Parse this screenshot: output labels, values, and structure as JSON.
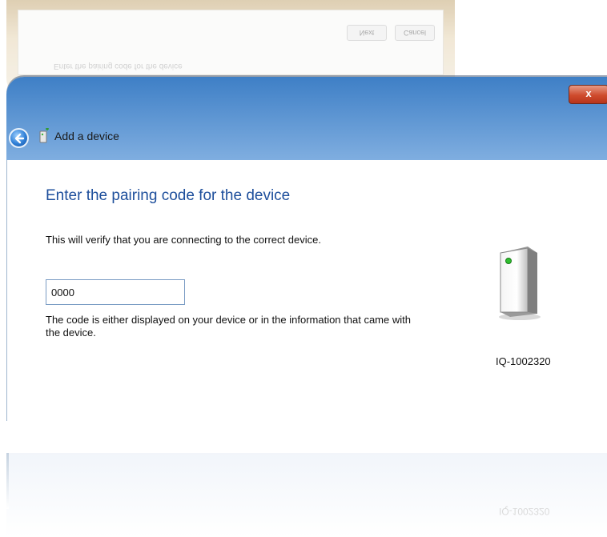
{
  "background_window": {
    "next_label": "Next",
    "cancel_label": "Cancel",
    "mirrored_text": "Enter the pairing code for the device"
  },
  "window": {
    "close_label": "x",
    "title": "Add a device"
  },
  "content": {
    "heading": "Enter the pairing code for the device",
    "description": "This will verify that you are connecting to the correct device.",
    "pairing_code_value": "0000",
    "hint": "The code is either displayed on your device or in the information that came with the device.",
    "device_name": "IQ-1002320"
  },
  "reflection": {
    "device_name": "IQ-1002320"
  },
  "colors": {
    "heading": "#1e4f9c",
    "close": "#cf4b2d",
    "titlebar": "#3e7fc6"
  },
  "icons": [
    "back-arrow-icon",
    "device-add-icon",
    "tower-device-icon"
  ]
}
